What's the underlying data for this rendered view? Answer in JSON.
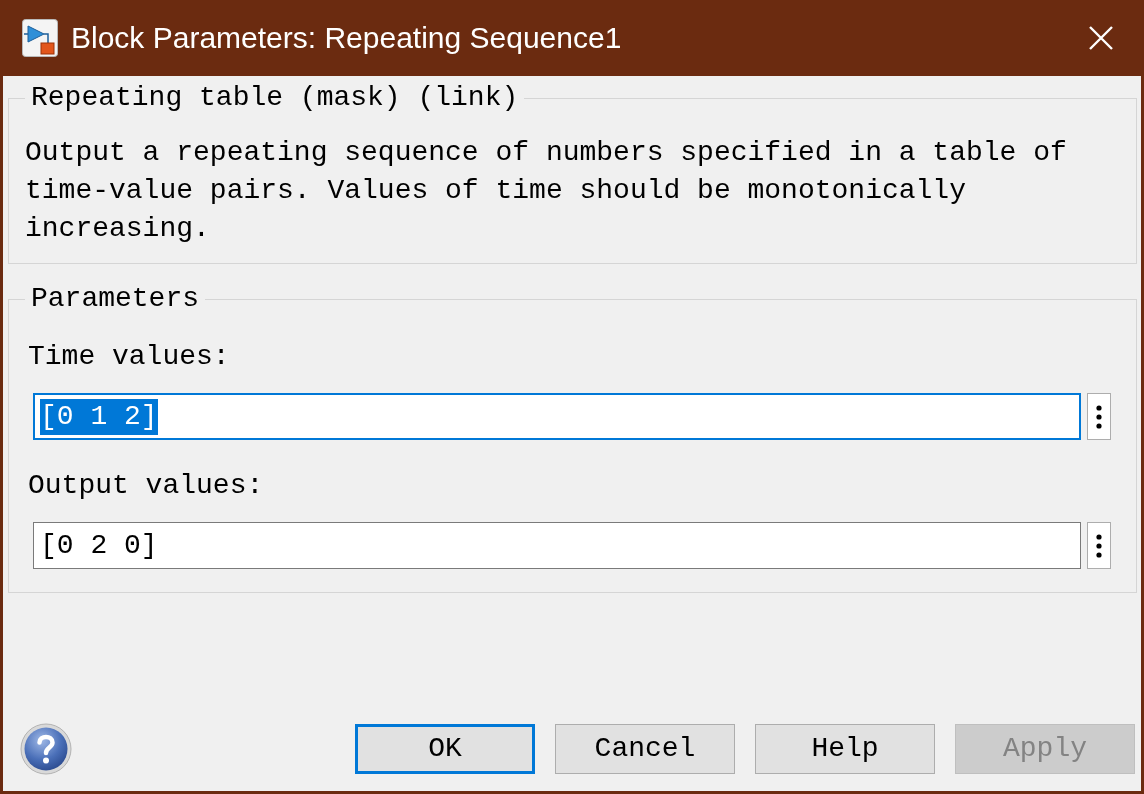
{
  "window": {
    "title": "Block Parameters: Repeating Sequence1"
  },
  "description_group": {
    "legend": "Repeating table (mask) (link)",
    "text": "Output a repeating sequence of numbers specified in a table of time-value pairs. Values of time should be monotonically increasing."
  },
  "parameters_group": {
    "legend": "Parameters",
    "fields": [
      {
        "label": "Time values:",
        "value": "[0 1 2]",
        "focused": true,
        "text_selected": true
      },
      {
        "label": "Output values:",
        "value": "[0 2 0]",
        "focused": false,
        "text_selected": false
      }
    ]
  },
  "buttons": [
    {
      "label": "OK",
      "default": true,
      "disabled": false
    },
    {
      "label": "Cancel",
      "default": false,
      "disabled": false
    },
    {
      "label": "Help",
      "default": false,
      "disabled": false
    },
    {
      "label": "Apply",
      "default": false,
      "disabled": true
    }
  ]
}
